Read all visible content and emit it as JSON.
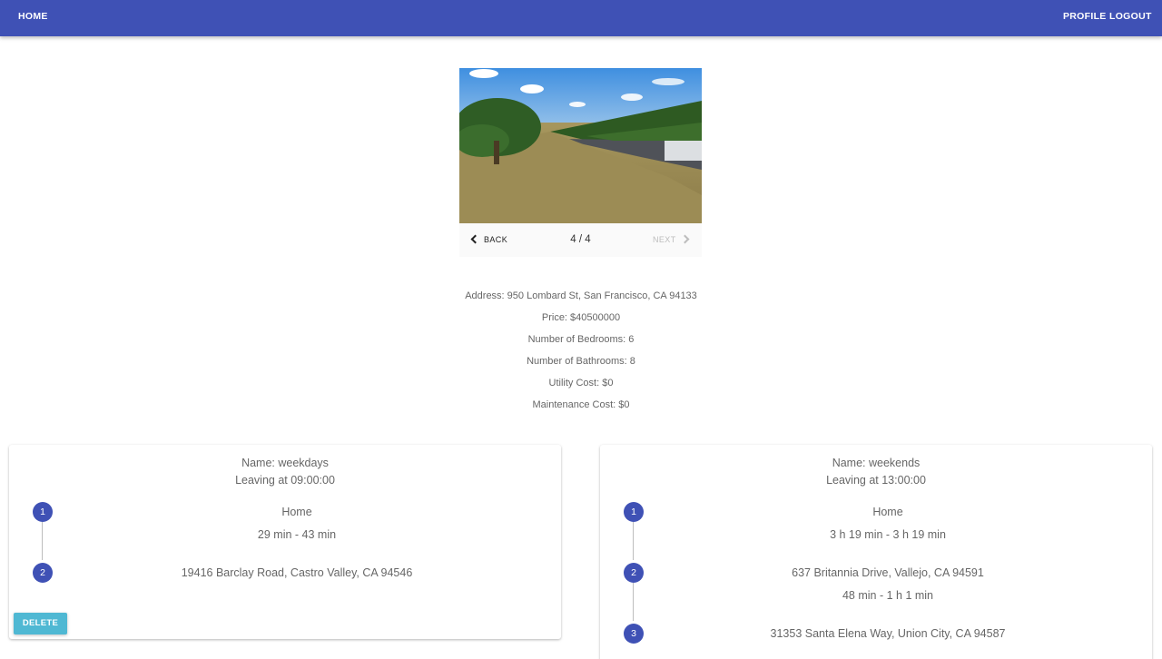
{
  "nav": {
    "home": "HOME",
    "profile": "PROFILE",
    "logout": "LOGOUT"
  },
  "gallery": {
    "back": "BACK",
    "next": "NEXT",
    "indicator": "4 / 4"
  },
  "details": {
    "address": "Address: 950 Lombard St, San Francisco, CA 94133",
    "price": "Price: $40500000",
    "bedrooms": "Number of Bedrooms: 6",
    "bathrooms": "Number of Bathrooms: 8",
    "utility": "Utility Cost: $0",
    "maintenance": "Maintenance Cost: $0"
  },
  "commutes": [
    {
      "name": "Name: weekdays",
      "leaving": "Leaving at 09:00:00",
      "stops": [
        {
          "num": "1",
          "label": "Home",
          "duration": "29 min - 43 min"
        },
        {
          "num": "2",
          "label": "19416 Barclay Road, Castro Valley, CA 94546"
        }
      ],
      "delete": "DELETE"
    },
    {
      "name": "Name: weekends",
      "leaving": "Leaving at 13:00:00",
      "stops": [
        {
          "num": "1",
          "label": "Home",
          "duration": "3 h 19 min - 3 h 19 min"
        },
        {
          "num": "2",
          "label": "637 Britannia Drive, Vallejo, CA 94591",
          "duration": "48 min - 1 h 1 min"
        },
        {
          "num": "3",
          "label": "31353 Santa Elena Way, Union City, CA 94587"
        }
      ]
    }
  ],
  "colors": {
    "primary": "#3f51b5",
    "accent": "#4fb8d3"
  }
}
